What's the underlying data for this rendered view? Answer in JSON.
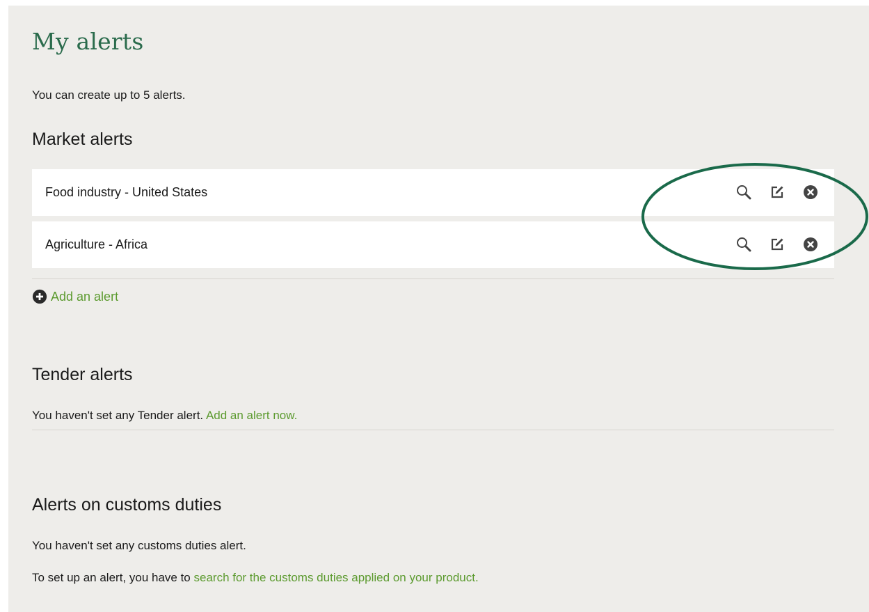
{
  "page": {
    "title": "My alerts",
    "intro": "You can create up to 5 alerts."
  },
  "market": {
    "heading": "Market alerts",
    "items": [
      {
        "label": "Food industry - United States"
      },
      {
        "label": "Agriculture - Africa"
      }
    ],
    "add_label": "Add an alert"
  },
  "tender": {
    "heading": "Tender alerts",
    "empty_text": "You haven't set any Tender alert.",
    "add_link": "Add an alert now."
  },
  "customs": {
    "heading": "Alerts on customs duties",
    "empty_text": "You haven't set any customs duties alert.",
    "setup_prefix": "To set up an alert, you have to",
    "setup_link": "search for the customs duties applied on your product."
  },
  "icons": {
    "view": "search-icon",
    "edit": "edit-icon",
    "remove": "remove-icon",
    "add": "add-circle-icon"
  },
  "colors": {
    "background": "#eeedea",
    "title_green": "#2a6b4c",
    "link_green": "#5b9a2e",
    "icon_dark": "#444444",
    "highlight_ellipse": "#1a6a4a"
  }
}
